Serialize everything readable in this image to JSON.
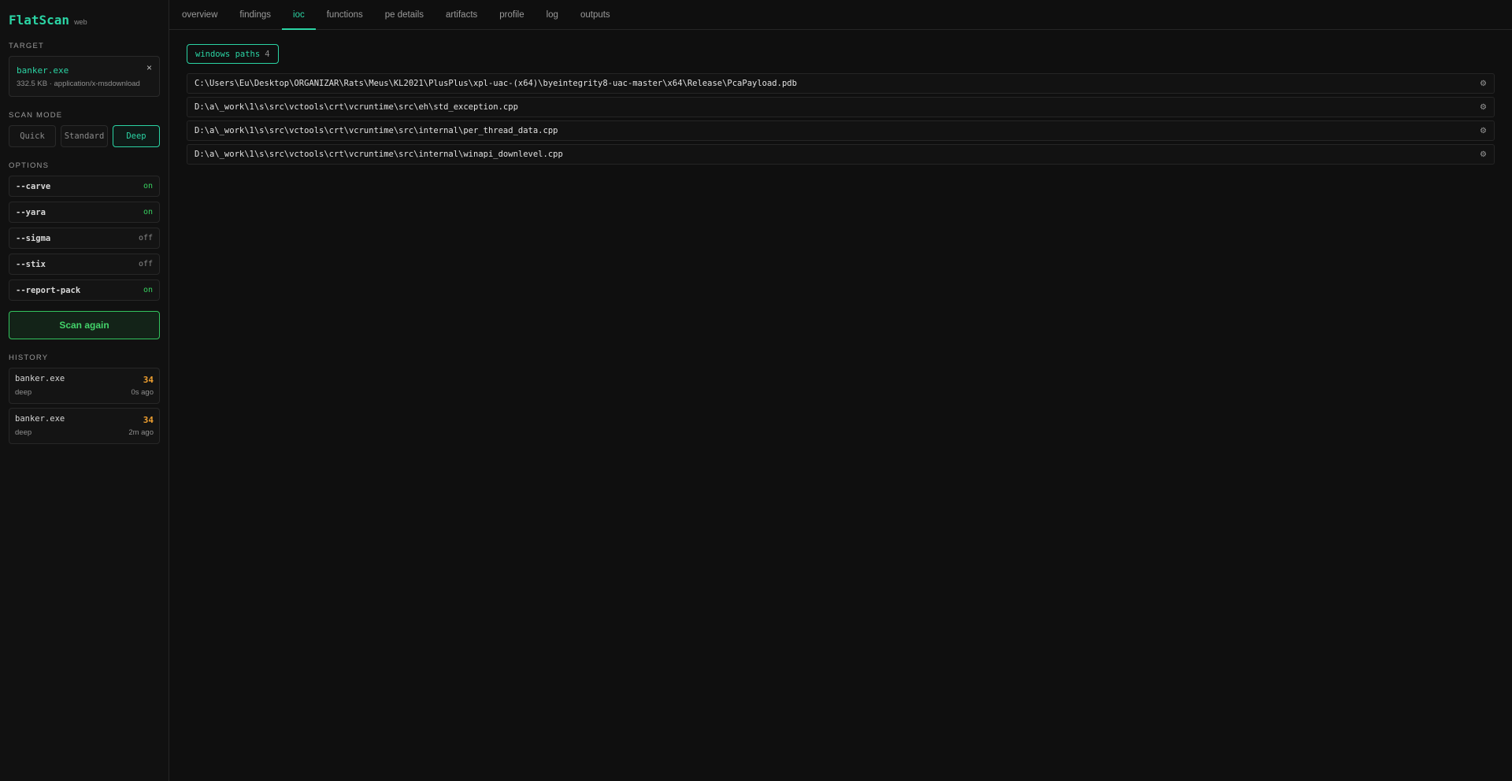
{
  "brand": {
    "name": "FlatScan",
    "tag": "web"
  },
  "sidebar": {
    "target_label": "TARGET",
    "target": {
      "name": "banker.exe",
      "meta": "332.5 KB · application/x-msdownload",
      "close_icon": "×"
    },
    "scan_mode_label": "SCAN MODE",
    "modes": [
      "Quick",
      "Standard",
      "Deep"
    ],
    "active_mode": "Deep",
    "options_label": "OPTIONS",
    "options": [
      {
        "name": "--carve",
        "value": "on"
      },
      {
        "name": "--yara",
        "value": "on"
      },
      {
        "name": "--sigma",
        "value": "off"
      },
      {
        "name": "--stix",
        "value": "off"
      },
      {
        "name": "--report-pack",
        "value": "on"
      }
    ],
    "scan_button": "Scan again",
    "history_label": "HISTORY",
    "history": [
      {
        "name": "banker.exe",
        "mode": "deep",
        "score": "34",
        "time": "0s ago"
      },
      {
        "name": "banker.exe",
        "mode": "deep",
        "score": "34",
        "time": "2m ago"
      }
    ]
  },
  "tabs": [
    "overview",
    "findings",
    "ioc",
    "functions",
    "pe details",
    "artifacts",
    "profile",
    "log",
    "outputs"
  ],
  "active_tab": "ioc",
  "ioc": {
    "filter_chip": {
      "label": "windows paths",
      "count": "4"
    },
    "paths": [
      "C:\\Users\\Eu\\Desktop\\ORGANIZAR\\Rats\\Meus\\KL2021\\PlusPlus\\xpl-uac-(x64)\\byeintegrity8-uac-master\\x64\\Release\\PcaPayload.pdb",
      "D:\\a\\_work\\1\\s\\src\\vctools\\crt\\vcruntime\\src\\eh\\std_exception.cpp",
      "D:\\a\\_work\\1\\s\\src\\vctools\\crt\\vcruntime\\src\\internal\\per_thread_data.cpp",
      "D:\\a\\_work\\1\\s\\src\\vctools\\crt\\vcruntime\\src\\internal\\winapi_downlevel.cpp"
    ],
    "row_icon": "gear-icon"
  }
}
